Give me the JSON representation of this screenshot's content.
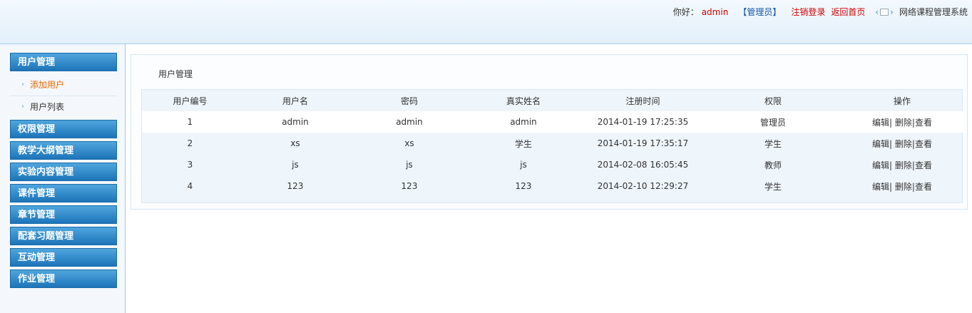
{
  "header": {
    "greeting": "你好：",
    "username": "admin",
    "role": "【管理员】",
    "logout": "注销登录",
    "home": "返回首页",
    "system_name": "网络课程管理系统"
  },
  "sidebar": {
    "sections": [
      {
        "label": "用户管理",
        "items": [
          {
            "label": "添加用户",
            "active": true
          },
          {
            "label": "用户列表",
            "active": false
          }
        ]
      },
      {
        "label": "权限管理"
      },
      {
        "label": "教学大纲管理"
      },
      {
        "label": "实验内容管理"
      },
      {
        "label": "课件管理"
      },
      {
        "label": "章节管理"
      },
      {
        "label": "配套习题管理"
      },
      {
        "label": "互动管理"
      },
      {
        "label": "作业管理"
      }
    ]
  },
  "main": {
    "title": "用户管理",
    "table": {
      "columns": [
        "用户编号",
        "用户名",
        "密码",
        "真实姓名",
        "注册时间",
        "权限",
        "操作"
      ],
      "rows": [
        [
          "1",
          "admin",
          "admin",
          "admin",
          "2014-01-19 17:25:35",
          "管理员"
        ],
        [
          "2",
          "xs",
          "xs",
          "学生",
          "2014-01-19 17:35:17",
          "学生"
        ],
        [
          "3",
          "js",
          "js",
          "js",
          "2014-02-08 16:05:45",
          "教师"
        ],
        [
          "4",
          "123",
          "123",
          "123",
          "2014-02-10 12:29:27",
          "学生"
        ]
      ],
      "actions": {
        "edit": "编辑",
        "delete": "删除",
        "view": "查看",
        "sep": "|"
      }
    }
  }
}
